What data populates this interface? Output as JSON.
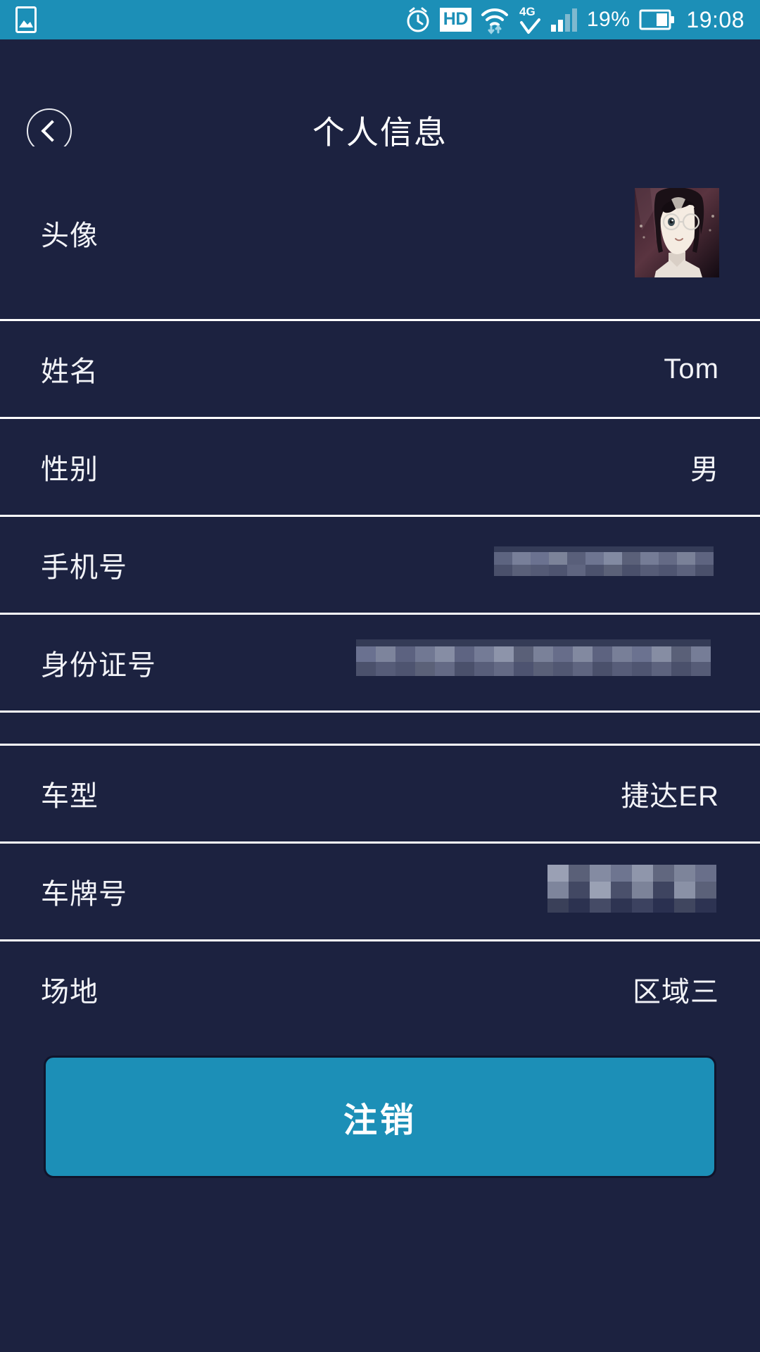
{
  "status_bar": {
    "background_color": "#1c8fb7",
    "left_icons": [
      {
        "name": "photo-icon",
        "label": "photo"
      }
    ],
    "right_icons": [
      {
        "name": "alarm-clock-icon",
        "label": "alarm"
      },
      {
        "name": "hd-badge-icon",
        "label": "HD"
      },
      {
        "name": "wifi-data-icon",
        "label": "wifi"
      },
      {
        "name": "network-4g-icon",
        "label": "4G"
      },
      {
        "name": "signal-bars-icon",
        "label": "signal"
      }
    ],
    "battery_percent": "19%",
    "time": "19:08"
  },
  "header": {
    "title": "个人信息",
    "back_icon": "chevron-left-icon"
  },
  "theme": {
    "background": "#1c2240",
    "accent": "#1c8fb7",
    "divider": "#ffffff",
    "text": "#f2f3f7"
  },
  "profile_rows": [
    {
      "label": "头像",
      "value": "",
      "type": "avatar"
    },
    {
      "label": "姓名",
      "value": "Tom",
      "type": "text"
    },
    {
      "label": "性别",
      "value": "男",
      "type": "text"
    },
    {
      "label": "手机号",
      "value": "",
      "type": "redacted"
    },
    {
      "label": "身份证号",
      "value": "",
      "type": "redacted"
    }
  ],
  "vehicle_rows": [
    {
      "label": "车型",
      "value": "捷达ER",
      "type": "text"
    },
    {
      "label": "车牌号",
      "value": "",
      "type": "redacted"
    },
    {
      "label": "场地",
      "value": "区域三",
      "type": "text"
    }
  ],
  "footer": {
    "logout_label": "注销"
  }
}
